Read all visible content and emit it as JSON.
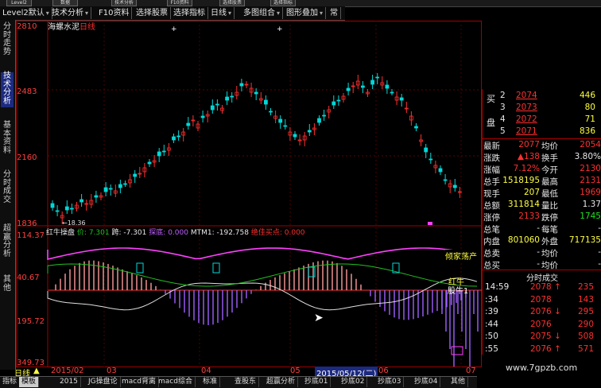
{
  "window": {
    "top_buttons": [
      "Level2",
      "数据",
      "技术分析",
      "F10资料",
      "选择股票",
      "选择指标",
      "委托"
    ]
  },
  "menubar": {
    "items": [
      {
        "label": "Level2默认",
        "dd": "▾"
      },
      {
        "label": "技术分析",
        "dd": "▾"
      },
      {
        "label": "F10资料",
        "dd": ""
      },
      {
        "label": "选择股票",
        "dd": ""
      },
      {
        "label": "选择指标",
        "dd": ""
      },
      {
        "label": "日线",
        "dd": "▾"
      },
      {
        "label": "多图组合",
        "dd": "▾"
      },
      {
        "label": "图形叠加",
        "dd": "▾"
      },
      {
        "label": "常",
        "dd": ""
      }
    ]
  },
  "left_tabs": [
    "分时走势",
    "技术分析",
    "基本资料",
    "分时成交",
    "超赢分析",
    "其他"
  ],
  "stock": {
    "name": "海螺水泥",
    "period": "日线"
  },
  "price_axis": [
    "2810",
    "2483",
    "2160",
    "1836"
  ],
  "indicator_axis": [
    "114.37",
    "40.67",
    "195.72",
    "349.73"
  ],
  "low_marker": "18.36",
  "indicator_legend": {
    "name": "红牛操盘",
    "v1_label": "价",
    "v1": "7.301",
    "v2_label": "跨",
    "v2": "-7.301",
    "v3_label": "探底",
    "v3": "0.000",
    "mtm_label": "MTM1",
    "mtm": "-192.758",
    "v4_label": "绝佳买点",
    "v4": "0.000"
  },
  "annotations": {
    "washout": "倾家荡产",
    "bull": "红牛",
    "bull2": "股牛1"
  },
  "order_book": {
    "sell": [
      {
        "level": "2",
        "price": "2074",
        "vol": "446"
      },
      {
        "level": "3",
        "price": "2073",
        "vol": "80"
      },
      {
        "level": "4",
        "price": "2072",
        "vol": "71"
      },
      {
        "level": "5",
        "price": "2071",
        "vol": "836"
      }
    ],
    "side_label_top": "买",
    "side_label_bottom": "盘"
  },
  "quote": [
    {
      "l1": "最新",
      "v1": "2077",
      "l2": "均价",
      "v2": "2054",
      "c1": "red",
      "c2": "red"
    },
    {
      "l1": "涨跌",
      "v1": "▲138",
      "l2": "换手",
      "v2": "3.80%",
      "c1": "red",
      "c2": "wht"
    },
    {
      "l1": "涨幅",
      "v1": "7.12%",
      "l2": "今开",
      "v2": "2130",
      "c1": "red",
      "c2": "red"
    },
    {
      "l1": "总手",
      "v1": "1518195",
      "l2": "最高",
      "v2": "2131",
      "c1": "yel",
      "c2": "red"
    },
    {
      "l1": "现手",
      "v1": "207",
      "l2": "最低",
      "v2": "1969",
      "c1": "yel",
      "c2": "red"
    },
    {
      "l1": "总额",
      "v1": "311814",
      "l2": "量比",
      "v2": "1.37",
      "c1": "yel",
      "c2": "wht"
    },
    {
      "l1": "涨停",
      "v1": "2133",
      "l2": "跌停",
      "v2": "1745",
      "c1": "red",
      "c2": "grn"
    },
    {
      "l1": "总笔",
      "v1": "-",
      "l2": "每笔",
      "v2": "-",
      "c1": "wht",
      "c2": "wht"
    },
    {
      "l1": "内盘",
      "v1": "801060",
      "l2": "外盘",
      "v2": "717135",
      "c1": "yel",
      "c2": "yel"
    },
    {
      "l1": "总卖",
      "v1": "-",
      "l2": "均价",
      "v2": "-",
      "c1": "wht",
      "c2": "wht"
    },
    {
      "l1": "总买",
      "v1": "-",
      "l2": "均价",
      "v2": "-",
      "c1": "wht",
      "c2": "wht"
    }
  ],
  "ticks_header": "分时成交",
  "ticks": [
    {
      "t": "14:59",
      "p": "2078",
      "a": "↑",
      "v": "235",
      "pc": "red",
      "vc": "red"
    },
    {
      "t": ":34",
      "p": "2078",
      "a": "",
      "v": "143",
      "pc": "red",
      "vc": "red"
    },
    {
      "t": ":39",
      "p": "2076",
      "a": "↓",
      "v": "295",
      "pc": "red",
      "vc": "red"
    },
    {
      "t": ":44",
      "p": "2076",
      "a": "",
      "v": "290",
      "pc": "red",
      "vc": "red"
    },
    {
      "t": ":50",
      "p": "2075",
      "a": "↓",
      "v": "508",
      "pc": "red",
      "vc": "red"
    },
    {
      "t": ":55",
      "p": "2076",
      "a": "↑",
      "v": "571",
      "pc": "red",
      "vc": "red"
    }
  ],
  "time_axis": {
    "period_label": "日线",
    "arrow": "▲",
    "dates": [
      "2015/02",
      "03",
      "04",
      "05",
      "2015/05/12(二)",
      "06",
      "07"
    ]
  },
  "bottom_tabs": [
    "指标",
    "模板",
    "2015",
    "JG操盘论",
    "macd背离",
    "macd综合",
    "标准",
    "查股东",
    "超赢分析",
    "抄底01",
    "抄底02",
    "抄底03",
    "抄底04",
    "其他"
  ],
  "watermark": "www.7gpzb.com",
  "colors": {
    "up": "#ff3030",
    "down": "#00d8d8",
    "accent": "#1c2a80"
  }
}
